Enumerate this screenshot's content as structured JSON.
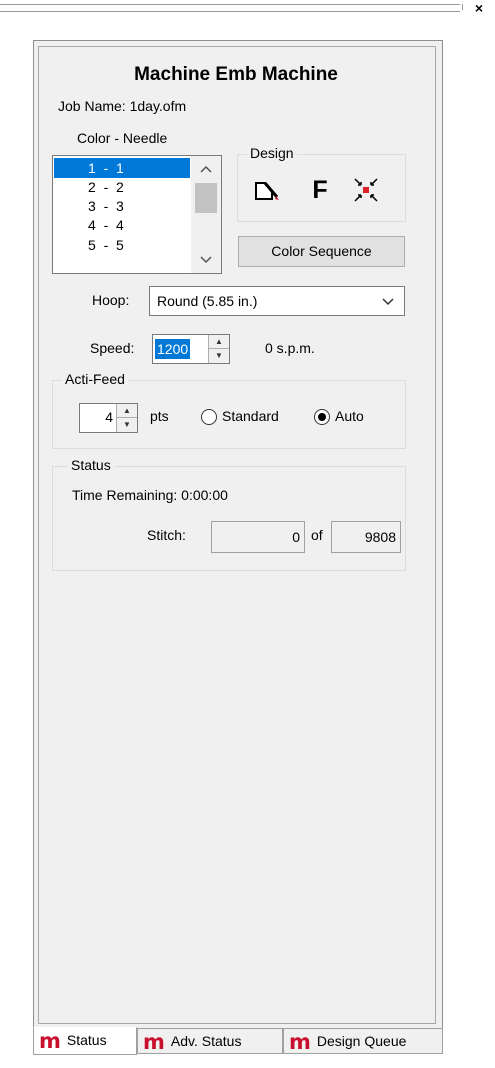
{
  "window": {
    "close_glyph": "×"
  },
  "header": {
    "title": "Machine Emb Machine",
    "job_name": "Job Name: 1day.ofm"
  },
  "color_needle": {
    "label": "Color - Needle",
    "items": [
      "1  -  1",
      "2  -  2",
      "3  -  3",
      "4  -  4",
      "5  -  5"
    ],
    "selected_index": 0
  },
  "design": {
    "label": "Design",
    "icons": [
      "edit-design-icon",
      "font-icon",
      "center-design-icon"
    ],
    "font_glyph": "F",
    "color_sequence_label": "Color Sequence"
  },
  "hoop": {
    "label": "Hoop:",
    "value": "Round (5.85 in.)"
  },
  "speed": {
    "label": "Speed:",
    "value": "1200",
    "actual": "0 s.p.m."
  },
  "acti_feed": {
    "label": "Acti-Feed",
    "value": "4",
    "unit": "pts",
    "options": [
      "Standard",
      "Auto"
    ],
    "selected": "Auto"
  },
  "status": {
    "label": "Status",
    "time_remaining": "Time Remaining:  0:00:00",
    "stitch_label": "Stitch:",
    "stitch_current": "0",
    "of_label": "of",
    "stitch_total": "9808"
  },
  "tabs": [
    {
      "label": "Status",
      "active": true
    },
    {
      "label": "Adv. Status",
      "active": false
    },
    {
      "label": "Design Queue",
      "active": false
    }
  ],
  "tab_logo_letter": "m",
  "colors": {
    "selection": "#0078d7",
    "tab_logo": "#c8102e",
    "panel_bg": "#f0f0f0"
  }
}
